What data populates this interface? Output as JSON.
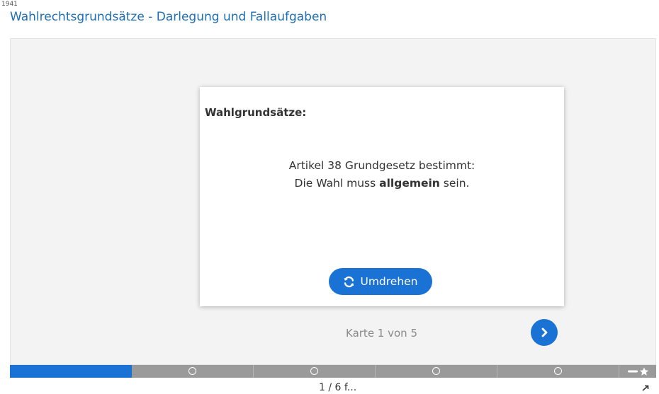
{
  "page": {
    "id_label": "1941",
    "title": "Wahlrechtsgrundsätze - Darlegung und Fallaufgaben"
  },
  "card": {
    "heading": "Wahlgrundsätze:",
    "line1": "Artikel 38 Grundgesetz bestimmt:",
    "line2_prefix": "Die Wahl muss ",
    "line2_bold": "allgemein",
    "line2_suffix": " sein.",
    "flip_label": "Umdrehen"
  },
  "navigation": {
    "counter": "Karte 1 von 5",
    "next_icon": "chevron-right-icon"
  },
  "progress": {
    "total_cards": 5,
    "current_card": 1,
    "segments": [
      {
        "state": "done"
      },
      {
        "state": "pending",
        "icon": "circle-icon"
      },
      {
        "state": "pending",
        "icon": "circle-icon"
      },
      {
        "state": "pending",
        "icon": "circle-icon"
      },
      {
        "state": "pending",
        "icon": "circle-icon"
      }
    ],
    "end_icon": "star-icon"
  },
  "footer": {
    "partial_text": "1 / 6 f...",
    "expand_icon": "expand-icon"
  },
  "colors": {
    "accent": "#1a73d4",
    "title": "#1f6fb5",
    "stage_bg": "#f3f3f3",
    "progress_bg": "#9a9a9a",
    "muted_text": "#8a8a8a"
  }
}
